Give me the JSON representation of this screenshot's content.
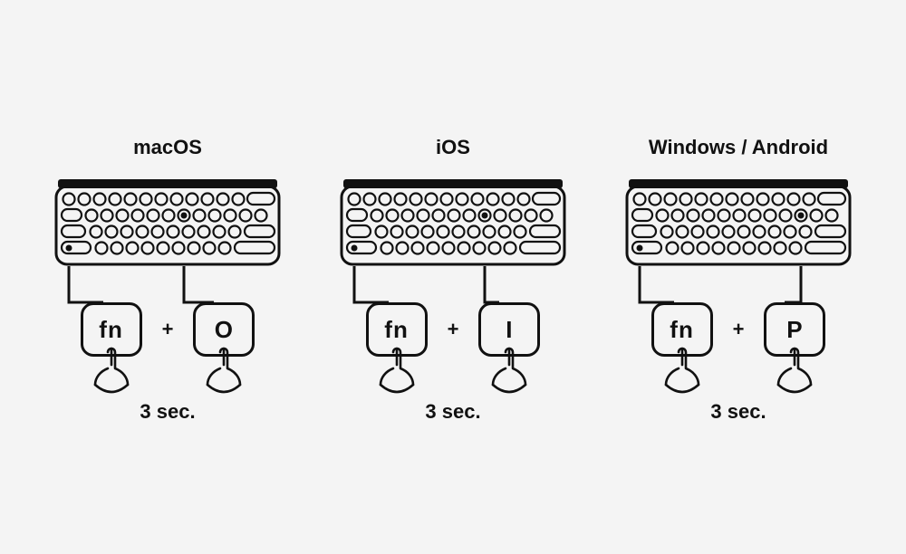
{
  "instructions": {
    "duration_label": "3 sec.",
    "plus": "+",
    "panels": [
      {
        "os": "macOS",
        "key1": "fn",
        "key2": "O"
      },
      {
        "os": "iOS",
        "key1": "fn",
        "key2": "I"
      },
      {
        "os": "Windows / Android",
        "key1": "fn",
        "key2": "P"
      }
    ]
  }
}
